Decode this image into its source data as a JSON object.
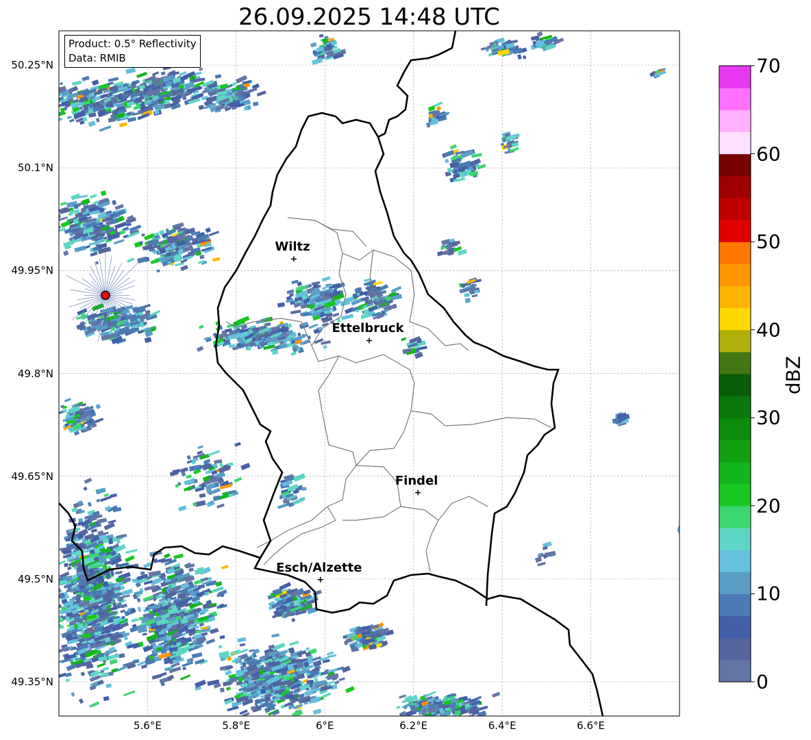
{
  "title": "26.09.2025 14:48 UTC",
  "info": {
    "product": "Product: 0.5° Reflectivity",
    "data": "Data: RMIB"
  },
  "axes": {
    "lat_labels": [
      "50.25°N",
      "50.1°N",
      "49.95°N",
      "49.8°N",
      "49.65°N",
      "49.5°N",
      "49.35°N"
    ],
    "lat_values": [
      50.25,
      50.1,
      49.95,
      49.8,
      49.65,
      49.5,
      49.35
    ],
    "lon_labels": [
      "5.6°E",
      "5.8°E",
      "6°E",
      "6.2°E",
      "6.4°E",
      "6.6°E"
    ],
    "lon_values": [
      5.6,
      5.8,
      6.0,
      6.2,
      6.4,
      6.6
    ],
    "lat_range": [
      49.3,
      50.3
    ],
    "lon_range": [
      5.4,
      6.8
    ],
    "gridlines": true
  },
  "cities": [
    {
      "name": "Wiltz",
      "lon": 5.93,
      "lat": 49.967
    },
    {
      "name": "Ettelbruck",
      "lon": 6.1,
      "lat": 49.848
    },
    {
      "name": "Findel",
      "lon": 6.21,
      "lat": 49.626
    },
    {
      "name": "Esch/Alzette",
      "lon": 5.99,
      "lat": 49.499
    }
  ],
  "radar_site": {
    "lon": 5.505,
    "lat": 49.914,
    "color": "#e01010"
  },
  "colorbar": {
    "label": "dBZ",
    "ticks": [
      "0",
      "10",
      "20",
      "30",
      "40",
      "50",
      "60",
      "70"
    ],
    "tick_values": [
      0,
      10,
      20,
      30,
      40,
      50,
      60,
      70
    ],
    "step": 2.5,
    "colors": [
      "#6475a6",
      "#5466a0",
      "#445fa8",
      "#4a7bb4",
      "#5a9ec8",
      "#64c0dc",
      "#5ed6c6",
      "#3dd670",
      "#18c81e",
      "#14b41c",
      "#10a010",
      "#0c8c0c",
      "#0a780a",
      "#085e08",
      "#447614",
      "#b0b00a",
      "#ffd800",
      "#ffb400",
      "#ff9600",
      "#ff7800",
      "#e00000",
      "#c00000",
      "#a00000",
      "#780000",
      "#ffe0ff",
      "#ffb0ff",
      "#ff70ff",
      "#e838f0"
    ]
  }
}
